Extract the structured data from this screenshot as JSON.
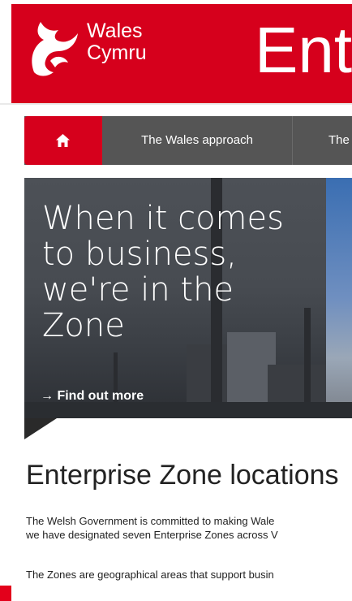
{
  "header": {
    "brand_line1": "Wales",
    "brand_line2": "Cymru",
    "title": "Ente",
    "brand_color": "#d6001c"
  },
  "nav": {
    "home_icon": "home-icon",
    "items": [
      {
        "label": "The Wales approach"
      },
      {
        "label": "The"
      }
    ]
  },
  "hero": {
    "headline": "When it comes to business, we're in the Zone",
    "cta_arrow": "→",
    "cta_label": "Find out more"
  },
  "main": {
    "section_title": "Enterprise Zone locations",
    "paragraph1_line1": "The Welsh Government is committed to making Wale",
    "paragraph1_line2": "we have designated seven Enterprise Zones across V",
    "paragraph2_line1": "The Zones are geographical areas that support busin"
  }
}
